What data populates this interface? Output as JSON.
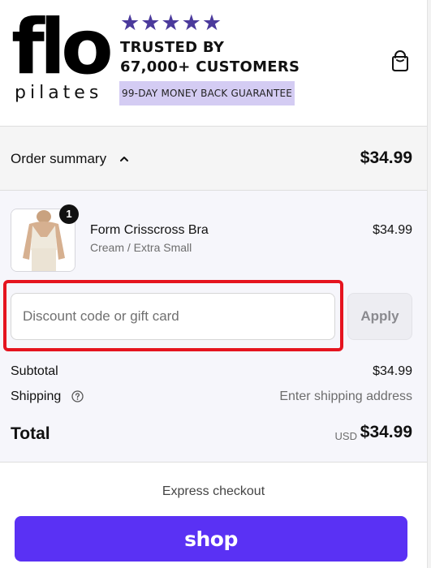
{
  "header": {
    "logo_main": "flo",
    "logo_sub": "pilates",
    "stars": "★★★★★",
    "trust_line1": "TRUSTED BY",
    "trust_line2": "67,000+ CUSTOMERS",
    "guarantee": "99-DAY MONEY BACK GUARANTEE"
  },
  "order_summary": {
    "label": "Order summary",
    "total": "$34.99"
  },
  "cart": {
    "items": [
      {
        "quantity": "1",
        "name": "Form Crisscross Bra",
        "variant": "Cream / Extra Small",
        "price": "$34.99"
      }
    ]
  },
  "discount": {
    "placeholder": "Discount code or gift card",
    "value": "",
    "apply_label": "Apply"
  },
  "totals": {
    "subtotal_label": "Subtotal",
    "subtotal_value": "$34.99",
    "shipping_label": "Shipping",
    "shipping_value": "Enter shipping address",
    "total_label": "Total",
    "currency": "USD",
    "total_value": "$34.99"
  },
  "express": {
    "label": "Express checkout",
    "shop_button": "shop"
  },
  "colors": {
    "brand_star": "#4b3a9c",
    "guarantee_bg": "#d4ccf3",
    "shop_pay": "#5a31f4",
    "highlight": "#e5141f"
  }
}
